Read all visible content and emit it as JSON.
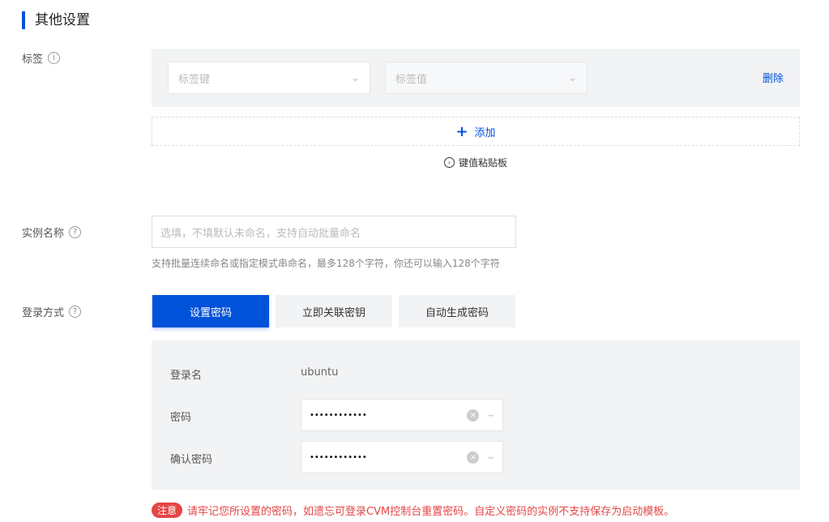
{
  "section_title": "其他设置",
  "tags": {
    "label": "标签",
    "key_placeholder": "标签键",
    "value_placeholder": "标签值",
    "delete": "删除",
    "add": "添加",
    "paste": "键值粘贴板"
  },
  "instance_name": {
    "label": "实例名称",
    "placeholder": "选填，不填默认未命名，支持自动批量命名",
    "hint": "支持批量连续命名或指定模式串命名，最多128个字符，你还可以输入128个字符"
  },
  "login": {
    "label": "登录方式",
    "options": [
      "设置密码",
      "立即关联密钥",
      "自动生成密码"
    ],
    "username_label": "登录名",
    "username": "ubuntu",
    "password_label": "密码",
    "password": "••••••••••••",
    "confirm_label": "确认密码",
    "confirm": "••••••••••••"
  },
  "note": {
    "badge": "注意",
    "text": "请牢记您所设置的密码，如遗忘可登录CVM控制台重置密码。自定义密码的实例不支持保存为启动模板。"
  }
}
